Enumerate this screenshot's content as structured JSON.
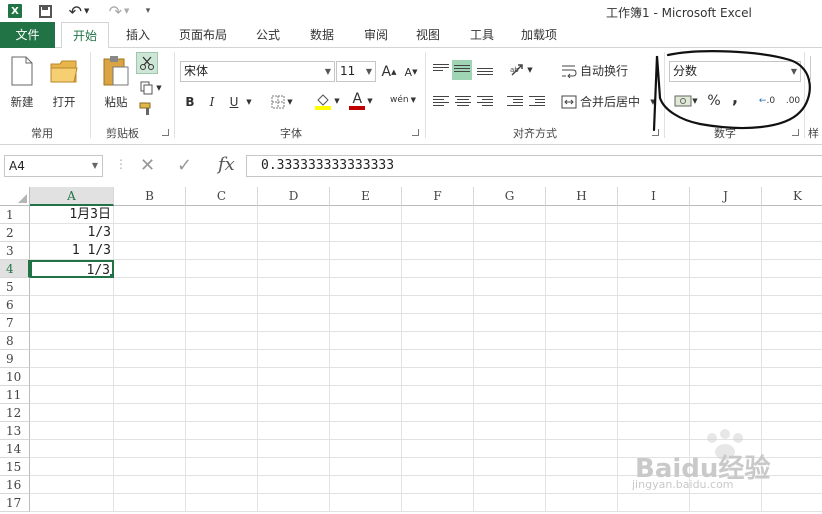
{
  "window": {
    "title": "工作簿1 - Microsoft Excel"
  },
  "quick_access": {
    "excel_icon": "excel-logo-icon",
    "save_icon": "save-icon",
    "undo_icon": "undo-icon",
    "redo_icon": "redo-icon",
    "customize_icon": "customize-icon"
  },
  "tabs": [
    {
      "label": "文件"
    },
    {
      "label": "开始"
    },
    {
      "label": "插入"
    },
    {
      "label": "页面布局"
    },
    {
      "label": "公式"
    },
    {
      "label": "数据"
    },
    {
      "label": "审阅"
    },
    {
      "label": "视图"
    },
    {
      "label": "工具"
    },
    {
      "label": "加载项"
    }
  ],
  "active_tab": "开始",
  "ribbon": {
    "common": {
      "group_label": "常用",
      "new_label": "新建",
      "open_label": "打开"
    },
    "clipboard": {
      "group_label": "剪贴板",
      "paste_label": "粘贴"
    },
    "font": {
      "group_label": "字体",
      "font_name": "宋体",
      "font_size": "11",
      "bold": "B",
      "italic": "I",
      "underline": "U",
      "grow": "A",
      "shrink": "A",
      "font_color_letter": "A",
      "phonetic": "wén"
    },
    "alignment": {
      "group_label": "对齐方式",
      "wrap_label": "自动换行",
      "merge_label": "合并后居中"
    },
    "number": {
      "group_label": "数字",
      "format_value": "分数",
      "percent": "%",
      "comma": ",",
      "inc_decimal": ".0",
      "dec_decimal": ".00"
    },
    "styles": {
      "group_label_partial": "样"
    }
  },
  "formula_bar": {
    "name_box": "A4",
    "fx_label": "fx",
    "content": "0.333333333333333"
  },
  "grid": {
    "columns": [
      "A",
      "B",
      "C",
      "D",
      "E",
      "F",
      "G",
      "H",
      "I",
      "J",
      "K"
    ],
    "rows": [
      "1",
      "2",
      "3",
      "4",
      "5",
      "6",
      "7",
      "8",
      "9",
      "10",
      "11",
      "12",
      "13",
      "14",
      "15",
      "16",
      "17"
    ],
    "selected_cell": "A4",
    "cells": {
      "A1": "1月3日",
      "A2": "1/3",
      "A3": "1 1/3",
      "A4": "1/3"
    }
  },
  "colors": {
    "accent": "#217346",
    "annotation": "#111111",
    "font_color_bar": "#c00000",
    "fill_color_bar": "#ffff00"
  },
  "watermark": {
    "brand": "Baidu经验",
    "url": "jingyan.baidu.com"
  }
}
